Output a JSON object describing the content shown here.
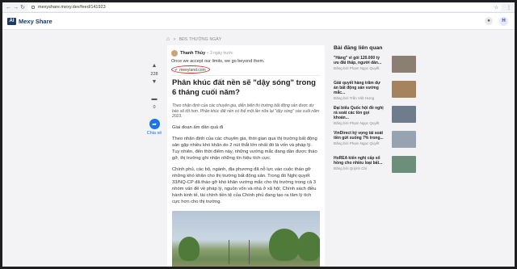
{
  "browser": {
    "url": "mexyshare.mexy.dev/feed/141923",
    "back": "←",
    "forward": "→",
    "reload": "↻"
  },
  "site": {
    "logo_mark": "AI",
    "logo_text": "Mexy Share",
    "user_initial": "H"
  },
  "breadcrumb": {
    "separator": ">",
    "current": "BĐS THƯỜNG NGÀY"
  },
  "rail": {
    "upvote_icon": "▲",
    "vote_count": "228",
    "downvote_icon": "▼",
    "comment_icon": "▬",
    "comment_count": "0",
    "share_icon": "➦",
    "share_label": "Chia sẻ"
  },
  "post": {
    "author": "Thanh Thủy",
    "time": "3 ngày trước",
    "caption": "Once we accept our limits, we go beyond them.",
    "source": "meeyland.com",
    "title": "Phân khúc đất nền sẽ \"dậy sóng\" trong 6 tháng cuối năm?",
    "lead": "Theo nhận định của các chuyên gia, diễn biến thị trường bất động sản được dự báo sẽ tốt hơn. Phân khúc đất nền có thể một lần nữa lại \"dậy sóng\" vào cuối năm 2023.",
    "p1": "Giai đoạn ấm dần quá đi",
    "p2": "Theo nhận định của các chuyên gia, thời gian qua thị trường bất động sản gặp nhiều khó khăn do 2 nút thắt lớn nhất đó là vốn và pháp lý. Tuy nhiên, đến thời điểm này, những vướng mắc đang dần được tháo gỡ, thị trường ghi nhận những tín hiệu tích cực.",
    "p3": "Chính phủ, các bộ, ngành, địa phương đã nỗ lực vào cuộc tháo gỡ những khó khăn cho thị trường bất động sản. Trong đó Nghị quyết 33/NQ-CP đã tháo gỡ khó khăn vướng mắc cho thị trường trong cả 3 nhóm vấn đề về pháp lý, nguồn vốn và nhà ở xã hội; Chính sách điều hành kinh tế, tài chính tiền tệ của Chính phủ đang tạo ra tâm lý tích cực hơn cho thị trường."
  },
  "related": {
    "heading": "Bài đăng liên quan",
    "items": [
      {
        "title": "\"Hàng\" vì gói 120.000 tỷ ưu đãi thấp, người dân...",
        "meta": "Đăng bởi Phạm Ngọc Quyết",
        "thumb_color": "#8a7f72"
      },
      {
        "title": "Giải quyết hàng trăm dự án bất động sản vướng mắc...",
        "meta": "Đăng bởi Trần Việt Hưng",
        "thumb_color": "#a5835e"
      },
      {
        "title": "Đại biểu Quốc hội đề nghị rà soát các tồn gọi khoản...",
        "meta": "Đăng bởi Phạm Ngọc Quyết",
        "thumb_color": "#6f7c8c"
      },
      {
        "title": "VinDirect ký vọng tái soát tiền gửi xuống 7% trong...",
        "meta": "Đăng bởi Phạm Ngọc Quyết",
        "thumb_color": "#97a3b1"
      },
      {
        "title": "HoREA kiến nghị cấp sổ hồng cho nhiều loại bất...",
        "meta": "Đăng bởi Quỳnh Chi",
        "thumb_color": "#6c8f7c"
      }
    ]
  }
}
